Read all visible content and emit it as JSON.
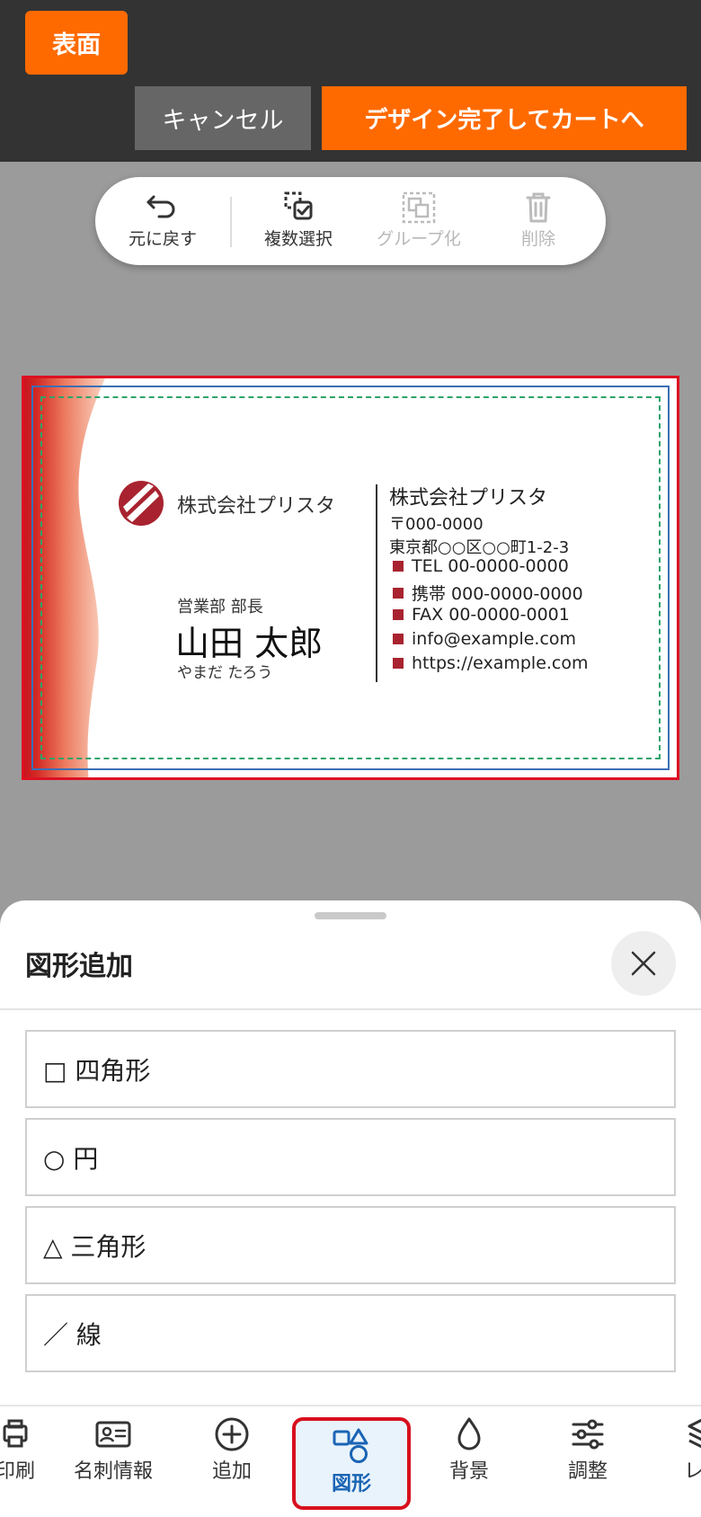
{
  "header": {
    "side_label": "表面",
    "cancel_label": "キャンセル",
    "done_label": "デザイン完了してカートへ"
  },
  "toolbar": {
    "undo": "元に戻す",
    "multi_select": "複数選択",
    "group": "グループ化",
    "delete": "削除"
  },
  "card": {
    "company": "株式会社プリスタ",
    "position": "営業部 部長",
    "name": "山田 太郎",
    "kana": "やまだ たろう",
    "company_right": "株式会社プリスタ",
    "postal": "〒000-0000",
    "address": "東京都○○区○○町1-2-3",
    "contacts": [
      "TEL 00-0000-0000",
      "携帯 000-0000-0000",
      "FAX 00-0000-0001",
      "info@example.com",
      "https://example.com"
    ],
    "accent_color": "#a8232f"
  },
  "sheet": {
    "title": "図形追加",
    "items": [
      "□ 四角形",
      "○ 円",
      "△ 三角形",
      "／ 線"
    ]
  },
  "bottom_nav": {
    "items": [
      "印刷",
      "名刺情報",
      "追加",
      "図形",
      "背景",
      "調整",
      "レイ"
    ],
    "active": "図形"
  },
  "colors": {
    "brand_orange": "#ff6a00",
    "header_dark": "#333333",
    "active_blue": "#1a64b4",
    "highlight_red": "#d8101e"
  }
}
